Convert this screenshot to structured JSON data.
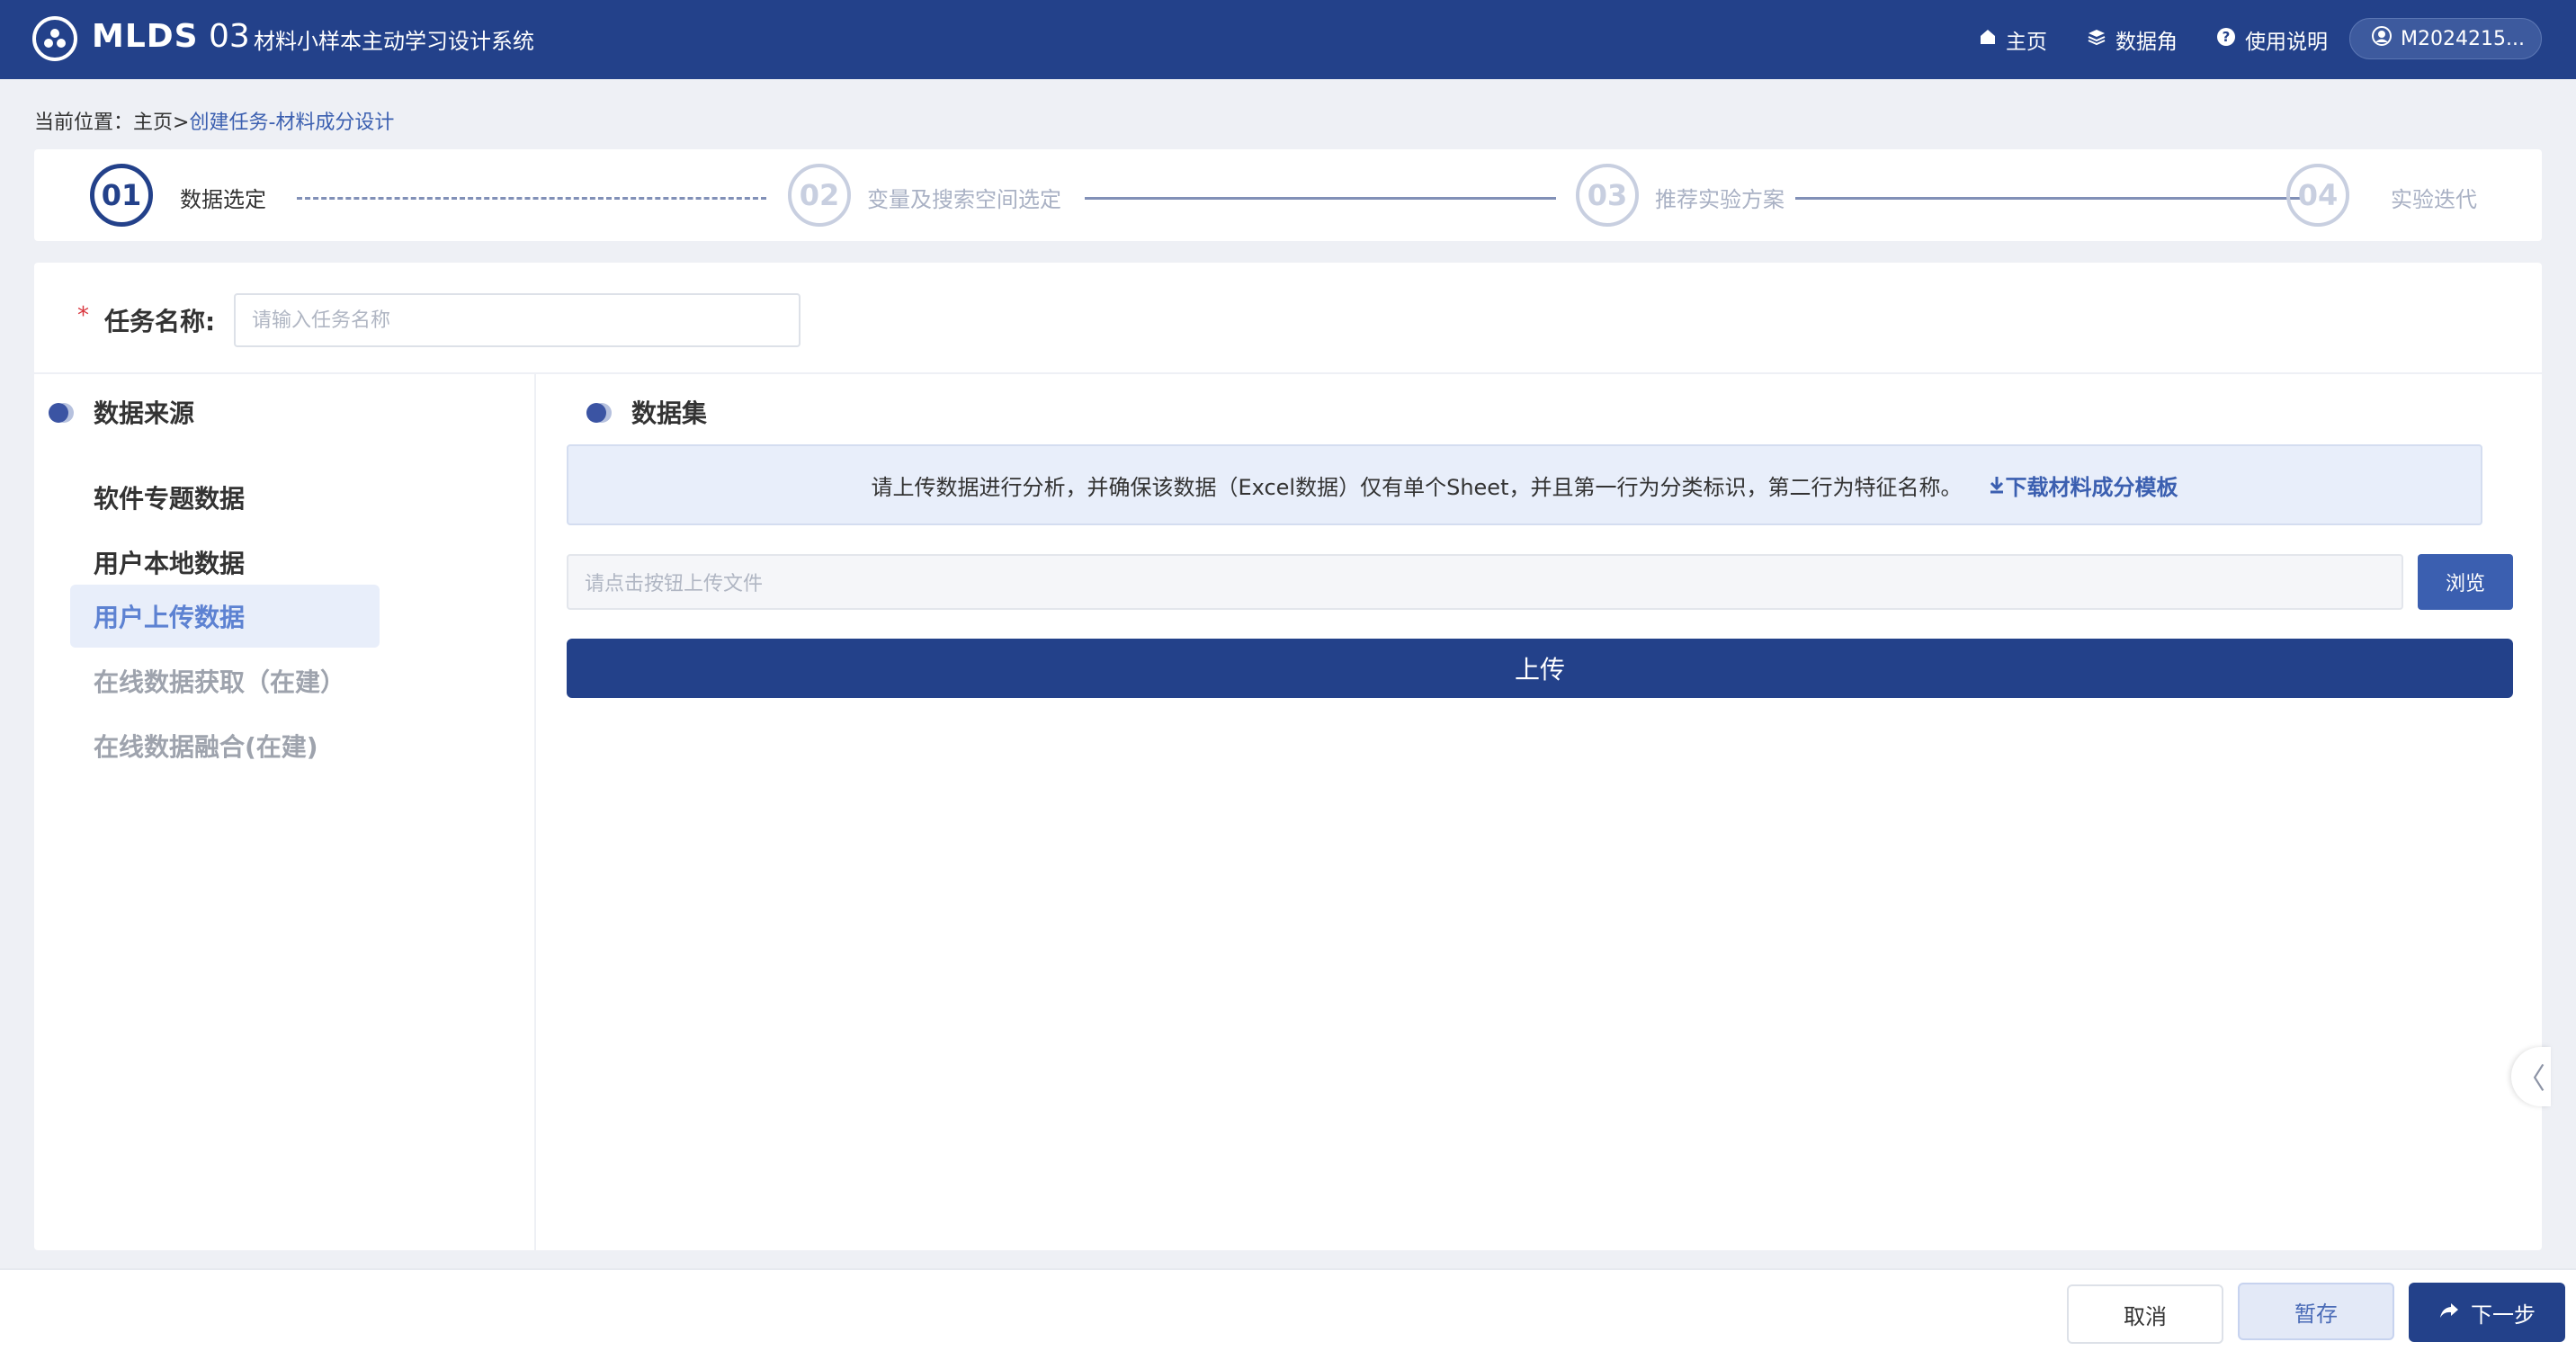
{
  "header": {
    "brand": "MLDS",
    "brand_num": "03",
    "app_title": "材料小样本主动学习设计系统",
    "nav": {
      "home": "主页",
      "data_corner": "数据角",
      "help": "使用说明"
    },
    "user": "M2024215..."
  },
  "breadcrumb": {
    "prefix": "当前位置：",
    "home": "主页",
    "separator": ">",
    "current": "创建任务-材料成分设计"
  },
  "steps": [
    {
      "num": "01",
      "label": "数据选定"
    },
    {
      "num": "02",
      "label": "变量及搜索空间选定"
    },
    {
      "num": "03",
      "label": "推荐实验方案"
    },
    {
      "num": "04",
      "label": "实验迭代"
    }
  ],
  "task": {
    "required_mark": "*",
    "label": "任务名称:",
    "placeholder": "请输入任务名称",
    "value": ""
  },
  "data_source": {
    "title": "数据来源",
    "items": [
      {
        "label": "软件专题数据"
      },
      {
        "label": "用户本地数据"
      },
      {
        "label": "用户上传数据"
      },
      {
        "label": "在线数据获取（在建）"
      },
      {
        "label": "在线数据融合(在建)"
      }
    ]
  },
  "dataset": {
    "title": "数据集",
    "notice": "请上传数据进行分析，并确保该数据（Excel数据）仅有单个Sheet，并且第一行为分类标识，第二行为特征名称。",
    "download_link": "下载材料成分模板",
    "file_placeholder": "请点击按钮上传文件",
    "browse": "浏览",
    "upload": "上传",
    "collapse": "〈"
  },
  "footer": {
    "cancel": "取消",
    "save": "暂存",
    "next": "下一步"
  },
  "colors": {
    "primary": "#23418a",
    "accent": "#3b5fb0",
    "selected_bg": "#e8eefa",
    "selected_text": "#5d82d2",
    "required": "#d9363e"
  }
}
